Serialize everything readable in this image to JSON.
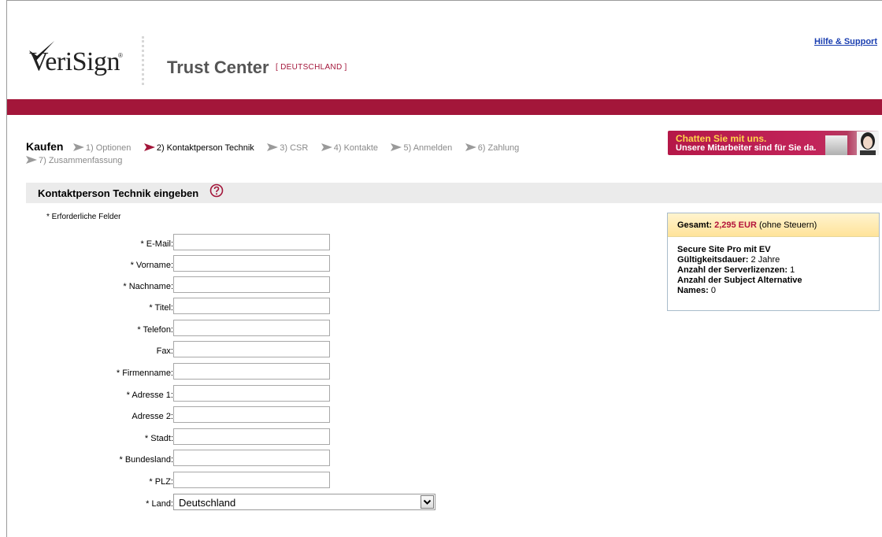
{
  "header": {
    "logo_text": "VeriSign",
    "title": "Trust Center",
    "country": "[ DEUTSCHLAND ]",
    "help_link": "Hilfe & Support"
  },
  "steps": {
    "title": "Kaufen",
    "items": [
      {
        "label": "1) Optionen",
        "active": false
      },
      {
        "label": "2) Kontaktperson Technik",
        "active": true
      },
      {
        "label": "3) CSR",
        "active": false
      },
      {
        "label": "4) Kontakte",
        "active": false
      },
      {
        "label": "5) Anmelden",
        "active": false
      },
      {
        "label": "6) Zahlung",
        "active": false
      },
      {
        "label": "7) Zusammenfassung",
        "active": false
      }
    ]
  },
  "chat": {
    "line1": "Chatten Sie mit uns.",
    "line2": "Unsere Mitarbeiter sind für Sie da."
  },
  "section": {
    "title": "Kontaktperson Technik eingeben",
    "required_note": "* Erforderliche Felder"
  },
  "form": {
    "fields": [
      {
        "label": "* E-Mail:",
        "value": ""
      },
      {
        "label": "* Vorname:",
        "value": ""
      },
      {
        "label": "* Nachname:",
        "value": ""
      },
      {
        "label": "* Titel:",
        "value": ""
      },
      {
        "label": "* Telefon:",
        "value": ""
      },
      {
        "label": "Fax:",
        "value": ""
      },
      {
        "label": "* Firmenname:",
        "value": ""
      },
      {
        "label": "* Adresse 1:",
        "value": ""
      },
      {
        "label": "Adresse 2:",
        "value": ""
      },
      {
        "label": "* Stadt:",
        "value": ""
      },
      {
        "label": "* Bundesland:",
        "value": ""
      },
      {
        "label": "* PLZ:",
        "value": ""
      }
    ],
    "country": {
      "label": "* Land:",
      "value": "Deutschland"
    }
  },
  "summary": {
    "total_label": "Gesamt:",
    "total_price": "2,295 EUR",
    "total_note": "(ohne Steuern)",
    "product": "Secure Site Pro mit EV",
    "validity_label": "Gültigkeitsdauer:",
    "validity_value": "2 Jahre",
    "licenses_label": "Anzahl der Serverlizenzen:",
    "licenses_value": "1",
    "san_label": "Anzahl der Subject Alternative Names:",
    "san_value": "0"
  },
  "colors": {
    "brand_red": "#a3163a",
    "link_blue": "#1a3eb0",
    "price_red": "#b3123a"
  }
}
